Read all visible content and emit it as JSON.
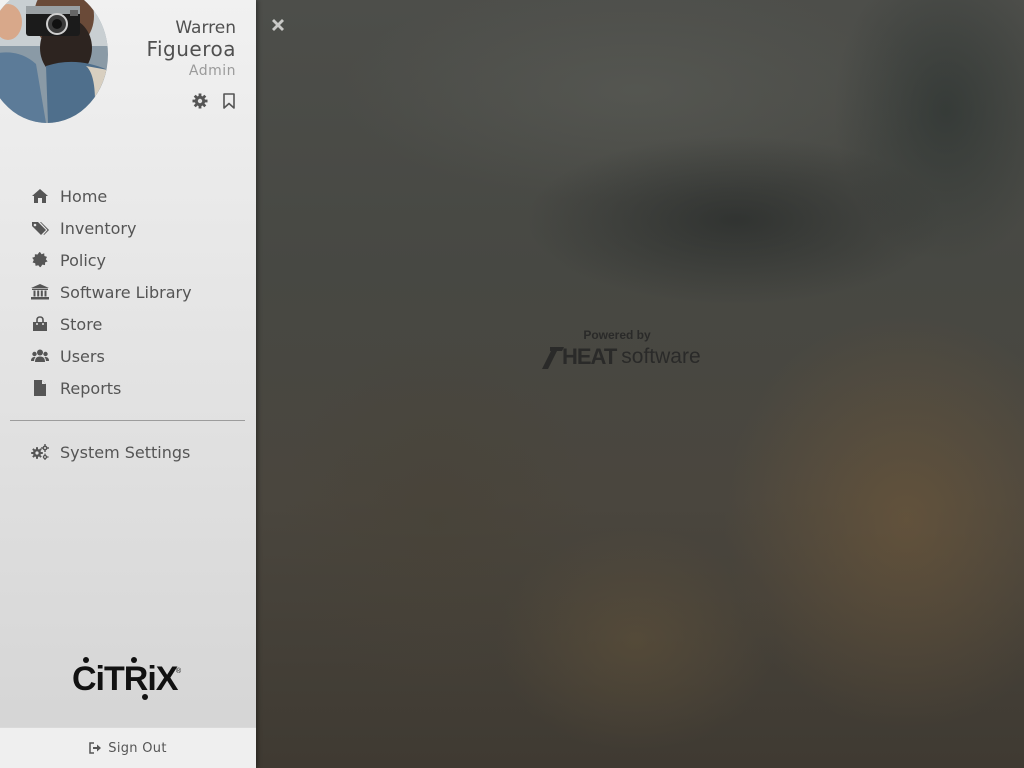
{
  "user": {
    "first_name": "Warren",
    "last_name": "Figueroa",
    "role": "Admin",
    "avatar_icon": "user-photo"
  },
  "header_actions": {
    "settings_icon": "gear-icon",
    "bookmark_icon": "bookmark-icon"
  },
  "nav": {
    "items": [
      {
        "label": "Home",
        "icon": "home-icon"
      },
      {
        "label": "Inventory",
        "icon": "tags-icon"
      },
      {
        "label": "Policy",
        "icon": "certificate-icon"
      },
      {
        "label": "Software Library",
        "icon": "bank-icon"
      },
      {
        "label": "Store",
        "icon": "shopping-bag-icon"
      },
      {
        "label": "Users",
        "icon": "users-icon"
      },
      {
        "label": "Reports",
        "icon": "file-icon"
      }
    ],
    "system_settings": {
      "label": "System Settings",
      "icon": "cogs-icon"
    }
  },
  "brand": {
    "logo_text": "CiTRiX",
    "registered": "®"
  },
  "signout": {
    "label": "Sign Out",
    "icon": "sign-out-icon"
  },
  "main": {
    "close_icon": "close-icon",
    "powered_by_label": "Powered by",
    "vendor_mark": "HEAT",
    "vendor_word": "software"
  },
  "colors": {
    "sidebar_bg": "#e4e4e4",
    "nav_text": "#555555",
    "backdrop": "#4a4a46"
  }
}
